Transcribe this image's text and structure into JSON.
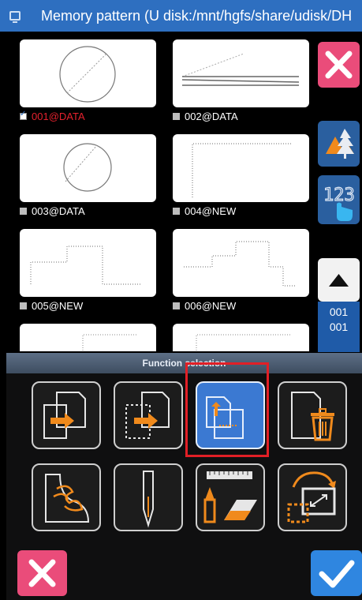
{
  "titlebar": {
    "title": "Memory pattern (U disk:/mnt/hgfs/share/udisk/DH"
  },
  "patterns": [
    {
      "label": "001@DATA",
      "selected": true,
      "shape": "circle"
    },
    {
      "label": "002@DATA",
      "selected": false,
      "shape": "lines"
    },
    {
      "label": "003@DATA",
      "selected": false,
      "shape": "circle"
    },
    {
      "label": "004@NEW",
      "selected": false,
      "shape": "corner"
    },
    {
      "label": "005@NEW",
      "selected": false,
      "shape": "step"
    },
    {
      "label": "006@NEW",
      "selected": false,
      "shape": "steps"
    },
    {
      "label": "",
      "selected": false,
      "shape": "partial"
    },
    {
      "label": "",
      "selected": false,
      "shape": "partial"
    }
  ],
  "page_indicator": {
    "current": "001",
    "total": "001"
  },
  "dialog": {
    "header": "Function selection",
    "buttons": [
      {
        "icon": "import-pattern-icon",
        "active": false
      },
      {
        "icon": "import-outline-icon",
        "active": false
      },
      {
        "icon": "copy-pattern-icon",
        "active": true
      },
      {
        "icon": "delete-pattern-icon",
        "active": false
      },
      {
        "icon": "embroidery-fill-icon",
        "active": false
      },
      {
        "icon": "needle-icon",
        "active": false
      },
      {
        "icon": "measure-edit-icon",
        "active": false
      },
      {
        "icon": "resize-rotate-icon",
        "active": false
      }
    ]
  },
  "colors": {
    "titlebar": "#2e6fc0",
    "accent_blue": "#3b79d2",
    "close_pink": "#ea4c7a",
    "selected_label": "#e5212d",
    "highlight_frame": "#e21f26",
    "icon_orange": "#f08a1c"
  }
}
